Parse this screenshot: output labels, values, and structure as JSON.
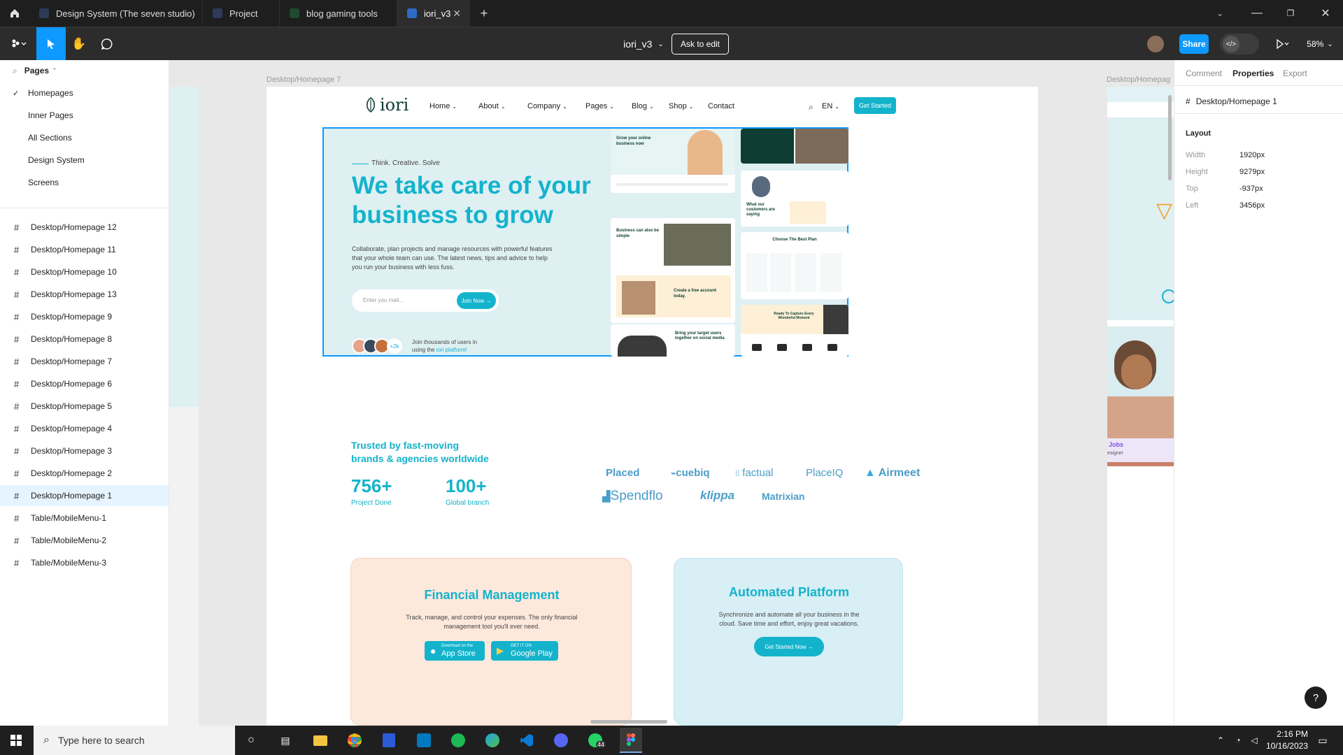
{
  "tabs": [
    {
      "label": "Design System (The seven studio)",
      "active": false
    },
    {
      "label": "Project",
      "active": false
    },
    {
      "label": "blog gaming tools",
      "active": false
    },
    {
      "label": "iori_v3",
      "active": true
    }
  ],
  "toolbar": {
    "file_name": "iori_v3",
    "ask_to_edit": "Ask to edit",
    "share": "Share",
    "zoom": "58%"
  },
  "left_panel": {
    "pages_label": "Pages",
    "pages": [
      "Homepages",
      "Inner Pages",
      "All Sections",
      "Design System",
      "Screens"
    ],
    "layers": [
      "Desktop/Homepage 12",
      "Desktop/Homepage 11",
      "Desktop/Homepage 10",
      "Desktop/Homepage 13",
      "Desktop/Homepage 9",
      "Desktop/Homepage 8",
      "Desktop/Homepage 7",
      "Desktop/Homepage 6",
      "Desktop/Homepage 5",
      "Desktop/Homepage 4",
      "Desktop/Homepage 3",
      "Desktop/Homepage 2",
      "Desktop/Homepage 1",
      "Table/MobileMenu-1",
      "Table/MobileMenu-2",
      "Table/MobileMenu-3"
    ],
    "selected_layer": "Desktop/Homepage 1"
  },
  "right_panel": {
    "tabs": [
      "Comment",
      "Properties",
      "Export"
    ],
    "active_tab": "Properties",
    "frame_name": "Desktop/Homepage 1",
    "layout_heading": "Layout",
    "props": [
      {
        "label": "Width",
        "value": "1920px"
      },
      {
        "label": "Height",
        "value": "9279px"
      },
      {
        "label": "Top",
        "value": "-937px"
      },
      {
        "label": "Left",
        "value": "3456px"
      }
    ]
  },
  "canvas": {
    "frame_label_left": "Desktop/Homepage 7",
    "frame_label_right": "Desktop/Homepag",
    "site": {
      "logo": "iori",
      "nav": [
        "Home",
        "About",
        "Company",
        "Pages",
        "Blog",
        "Shop",
        "Contact"
      ],
      "lang": "EN",
      "get_started": "Get Started",
      "tagline": "Think. Creative. Solve",
      "headline_1": "We take care of your",
      "headline_2": "business to grow",
      "description": "Collaborate, plan projects and manage resources with powerful features that your whole team can use.  The latest news, tips and advice to help you run your business with less fuss.",
      "email_placeholder": "Enter you mail...",
      "join_now": "Join Now",
      "users_count": "+2k",
      "join_text_1": "Join thousands of users in",
      "join_text_2": "using the",
      "join_text_brand": "iori platform!",
      "mock_1": "Grow your online business now",
      "mock_2": "Business can also be simple",
      "mock_3": "Create a free account today.",
      "mock_4": "Bring your target users together on social media",
      "mock_5": "Choose The Best Plan",
      "mock_6": "Ready To Capture Every Wonderful Moment",
      "mock_7": "What our customers are saying",
      "trusted_1": "Trusted by fast-moving",
      "trusted_2": "brands & agencies worldwide",
      "stat_1_value": "756+",
      "stat_1_label": "Project Done",
      "stat_2_value": "100+",
      "stat_2_label": "Global branch",
      "brands": [
        "Placed",
        "cuebiq",
        "factual",
        "PlaceIQ",
        "Airmeet",
        "Spendflo",
        "klippa",
        "Matrixian"
      ],
      "card_1_title": "Financial Management",
      "card_1_text": "Track, manage, and control your expenses. The only financial management tool you'll ever need.",
      "app_store_small": "Download on the",
      "app_store": "App Store",
      "google_play_small": "GET IT ON",
      "google_play": "Google Play",
      "card_2_title": "Automated Platform",
      "card_2_text": "Synchronize and automate all your business in the cloud. Save time and effort, enjoy great vacations.",
      "card_2_button": "Get Started Now",
      "side_jobs": "Jobs",
      "side_designer": "esigner"
    }
  },
  "taskbar": {
    "search_placeholder": "Type here to search",
    "time": "2:16 PM",
    "date": "10/16/2023",
    "whatsapp_badge": "44"
  },
  "colors": {
    "accent": "#0d99ff",
    "brand_cyan": "#14b3cc",
    "hero_bg": "#dff0f3",
    "card_peach": "#fde8dc",
    "card_blue": "#d8eff5",
    "dark_green": "#0d3d33"
  }
}
